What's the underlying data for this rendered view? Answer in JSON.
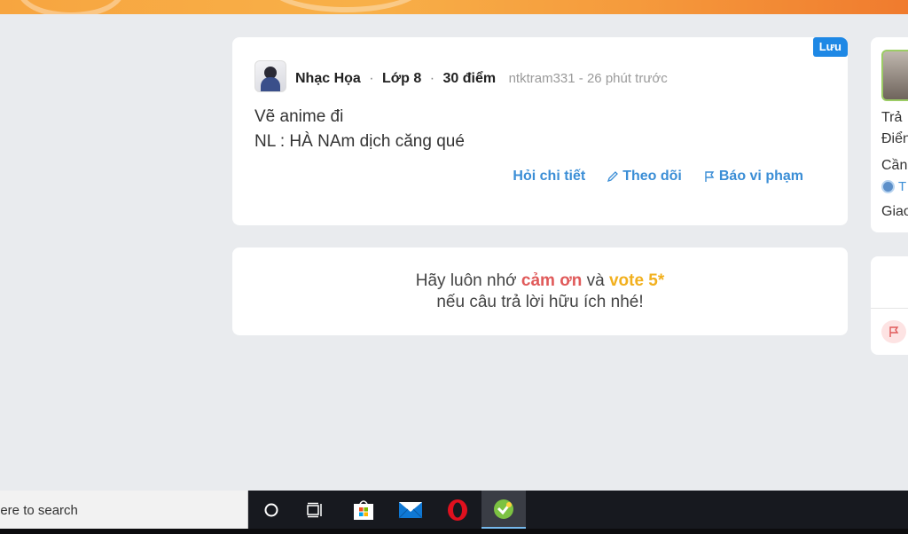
{
  "question": {
    "save_tag": "Lưu",
    "subject": "Nhạc Họa",
    "grade": "Lớp 8",
    "points": "30 điểm",
    "username": "ntktram331",
    "time_ago": "26 phút trước",
    "separator": "-",
    "dot": "·",
    "lines": [
      "Vẽ anime đi",
      "NL : HÀ NAm dịch căng qué"
    ],
    "actions": {
      "detail": "Hỏi chi tiết",
      "follow": "Theo dõi",
      "report": "Báo vi phạm"
    }
  },
  "reminder": {
    "part1": "Hãy luôn nhớ ",
    "thanks": "cảm ơn",
    "part2": " và ",
    "vote": "vote 5*",
    "line2": "nếu câu trả lời hữu ích nhé!"
  },
  "sidebar": {
    "line1": "Trả",
    "line2": "Điển",
    "line3": "Cần",
    "badge": "T",
    "line4": "Giao"
  },
  "taskbar": {
    "search_placeholder": "here to search",
    "icons": [
      "cortana-icon",
      "task-view-icon",
      "store-icon",
      "mail-icon",
      "opera-icon",
      "browser-icon"
    ]
  },
  "colors": {
    "accent": "#3b8ed6",
    "thanks": "#e05a5a",
    "vote": "#f2b01e",
    "save_tag": "#1e88e5"
  }
}
